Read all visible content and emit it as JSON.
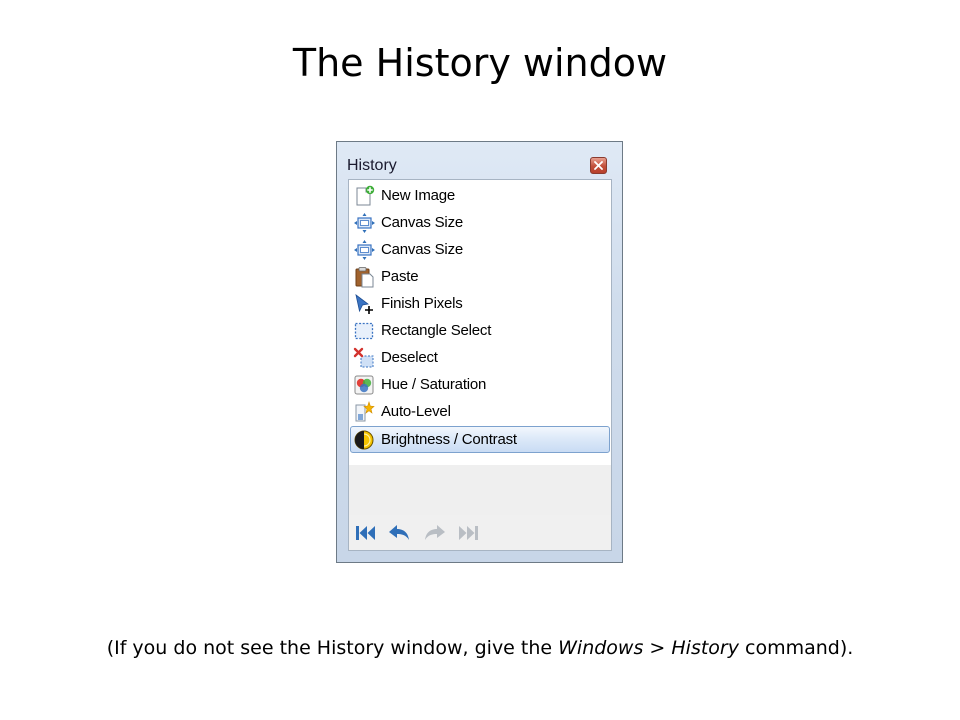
{
  "slide": {
    "title": "The History window",
    "caption_prefix": "(If you do not see the History window, give the ",
    "caption_menu": "Windows",
    "caption_sep": " > ",
    "caption_item": "History",
    "caption_suffix": " command)."
  },
  "window": {
    "title": "History",
    "close_icon": "close-icon"
  },
  "history_items": [
    {
      "label": "New Image",
      "icon": "new-image-icon"
    },
    {
      "label": "Canvas Size",
      "icon": "canvas-size-icon"
    },
    {
      "label": "Canvas Size",
      "icon": "canvas-size-icon"
    },
    {
      "label": "Paste",
      "icon": "paste-icon"
    },
    {
      "label": "Finish Pixels",
      "icon": "finish-pixels-icon"
    },
    {
      "label": "Rectangle Select",
      "icon": "rectangle-select-icon"
    },
    {
      "label": "Deselect",
      "icon": "deselect-icon"
    },
    {
      "label": "Hue / Saturation",
      "icon": "hue-saturation-icon"
    },
    {
      "label": "Auto-Level",
      "icon": "auto-level-icon"
    },
    {
      "label": "Brightness / Contrast",
      "icon": "brightness-contrast-icon",
      "selected": true
    }
  ],
  "nav_buttons": [
    {
      "icon": "rewind-to-start-icon",
      "enabled": true
    },
    {
      "icon": "undo-icon",
      "enabled": true
    },
    {
      "icon": "redo-icon",
      "enabled": false
    },
    {
      "icon": "fast-forward-to-end-icon",
      "enabled": false
    }
  ],
  "colors": {
    "selection_border": "#7da2ce",
    "window_frame": "#cfdcec",
    "nav_enabled": "#2f6fb8",
    "nav_disabled": "#b9bec4"
  }
}
